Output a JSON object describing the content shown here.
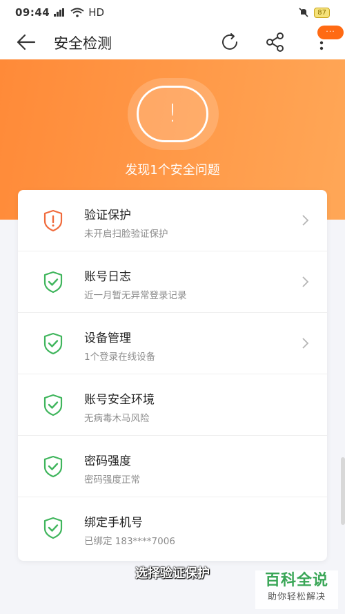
{
  "status_bar": {
    "time": "09:44",
    "network": "HD",
    "battery": "87"
  },
  "app_bar": {
    "title": "安全检测",
    "badge": "···"
  },
  "hero": {
    "alert_symbol": "!",
    "title": "发现1个安全问题"
  },
  "items": [
    {
      "title": "验证保护",
      "subtitle": "未开启扫脸验证保护",
      "status": "warning",
      "has_chevron": true
    },
    {
      "title": "账号日志",
      "subtitle": "近一月暂无异常登录记录",
      "status": "ok",
      "has_chevron": true
    },
    {
      "title": "设备管理",
      "subtitle": "1个登录在线设备",
      "status": "ok",
      "has_chevron": true
    },
    {
      "title": "账号安全环境",
      "subtitle": "无病毒木马风险",
      "status": "ok",
      "has_chevron": false
    },
    {
      "title": "密码强度",
      "subtitle": "密码强度正常",
      "status": "ok",
      "has_chevron": false
    },
    {
      "title": "绑定手机号",
      "subtitle": "已绑定 183****7006",
      "status": "ok",
      "has_chevron": false
    }
  ],
  "caption": "选择验证保护",
  "watermark": {
    "main": "百科全说",
    "sub": "助你轻松解决"
  },
  "colors": {
    "accent_orange": "#ff8a38",
    "ok_green": "#3fb55c",
    "warn_orange": "#f06a3b"
  }
}
